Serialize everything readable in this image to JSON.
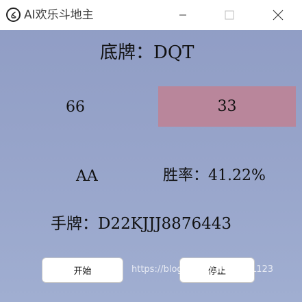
{
  "window": {
    "title": "AI欢乐斗地主"
  },
  "main": {
    "bottom_cards_label": "底牌：DQT",
    "left_score": "66",
    "right_score": "33",
    "hand_type": "AA",
    "win_rate_label": "胜率：41.22%",
    "hand_cards_label": "手牌：D22KJJJ8876443"
  },
  "buttons": {
    "start_label": "开始",
    "stop_label": "停止"
  },
  "watermark": "https://blog.csdn.net/@YunL123",
  "colors": {
    "background": "#97a3c8",
    "highlight_card": "#b9869b"
  }
}
